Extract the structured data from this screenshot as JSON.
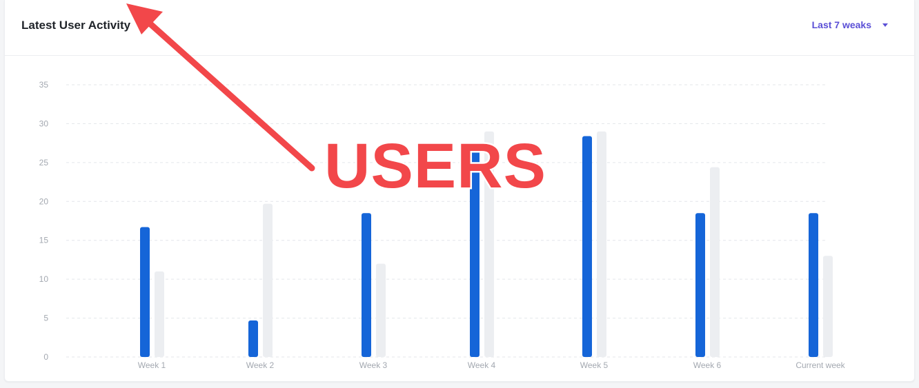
{
  "header": {
    "title": "Latest User Activity",
    "range_label": "Last 7 weaks"
  },
  "annotation": {
    "text": "USERS",
    "arrow_icon": "red-arrow-icon",
    "color": "#f2474a"
  },
  "colors": {
    "primary_bar": "#1565d8",
    "secondary_bar": "#eceef1",
    "accent": "#5a4fd6"
  },
  "chart_data": {
    "type": "bar",
    "categories": [
      "Week 1",
      "Week 2",
      "Week 3",
      "Week 4",
      "Week 5",
      "Week 6",
      "Current week"
    ],
    "series": [
      {
        "values": [
          16.7,
          4.7,
          18.5,
          26.8,
          28.4,
          18.5,
          18.5
        ]
      },
      {
        "values": [
          11.0,
          19.7,
          12.0,
          29.0,
          29.0,
          24.4,
          13.0
        ]
      }
    ],
    "ylim": [
      0,
      35
    ],
    "yticks": [
      0,
      5,
      10,
      15,
      20,
      25,
      30,
      35
    ],
    "grid": true,
    "legend": "none"
  }
}
